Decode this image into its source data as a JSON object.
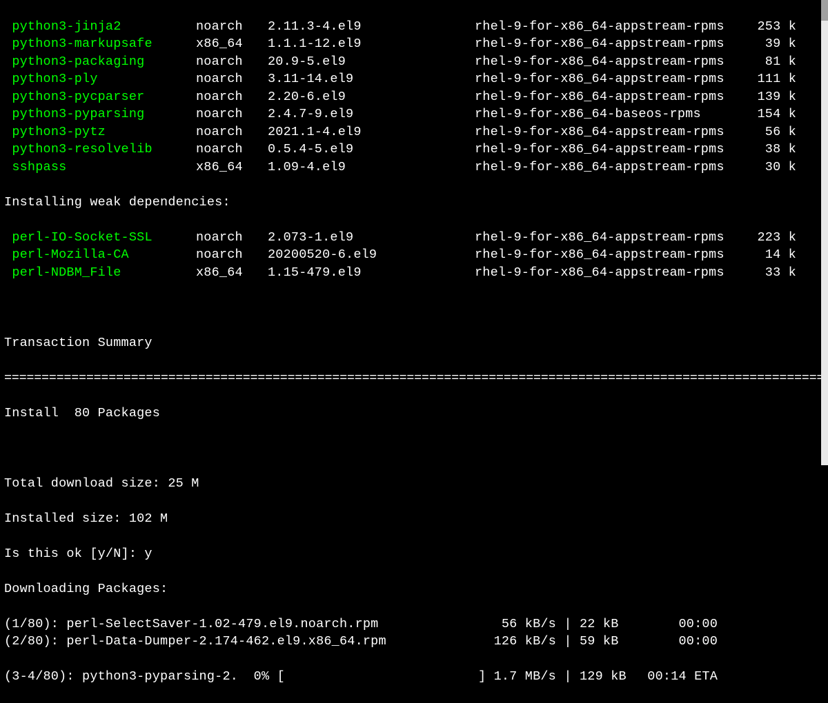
{
  "packages": [
    {
      "name": "python3-jinja2",
      "arch": "noarch",
      "version": "2.11.3-4.el9",
      "repo": "rhel-9-for-x86_64-appstream-rpms",
      "size": "253 k"
    },
    {
      "name": "python3-markupsafe",
      "arch": "x86_64",
      "version": "1.1.1-12.el9",
      "repo": "rhel-9-for-x86_64-appstream-rpms",
      "size": "39 k"
    },
    {
      "name": "python3-packaging",
      "arch": "noarch",
      "version": "20.9-5.el9",
      "repo": "rhel-9-for-x86_64-appstream-rpms",
      "size": "81 k"
    },
    {
      "name": "python3-ply",
      "arch": "noarch",
      "version": "3.11-14.el9",
      "repo": "rhel-9-for-x86_64-appstream-rpms",
      "size": "111 k"
    },
    {
      "name": "python3-pycparser",
      "arch": "noarch",
      "version": "2.20-6.el9",
      "repo": "rhel-9-for-x86_64-appstream-rpms",
      "size": "139 k"
    },
    {
      "name": "python3-pyparsing",
      "arch": "noarch",
      "version": "2.4.7-9.el9",
      "repo": "rhel-9-for-x86_64-baseos-rpms",
      "size": "154 k"
    },
    {
      "name": "python3-pytz",
      "arch": "noarch",
      "version": "2021.1-4.el9",
      "repo": "rhel-9-for-x86_64-appstream-rpms",
      "size": "56 k"
    },
    {
      "name": "python3-resolvelib",
      "arch": "noarch",
      "version": "0.5.4-5.el9",
      "repo": "rhel-9-for-x86_64-appstream-rpms",
      "size": "38 k"
    },
    {
      "name": "sshpass",
      "arch": "x86_64",
      "version": "1.09-4.el9",
      "repo": "rhel-9-for-x86_64-appstream-rpms",
      "size": "30 k"
    }
  ],
  "weak_header": "Installing weak dependencies:",
  "weak_packages": [
    {
      "name": "perl-IO-Socket-SSL",
      "arch": "noarch",
      "version": "2.073-1.el9",
      "repo": "rhel-9-for-x86_64-appstream-rpms",
      "size": "223 k"
    },
    {
      "name": "perl-Mozilla-CA",
      "arch": "noarch",
      "version": "20200520-6.el9",
      "repo": "rhel-9-for-x86_64-appstream-rpms",
      "size": "14 k"
    },
    {
      "name": "perl-NDBM_File",
      "arch": "x86_64",
      "version": "1.15-479.el9",
      "repo": "rhel-9-for-x86_64-appstream-rpms",
      "size": "33 k"
    }
  ],
  "summary_title": "Transaction Summary",
  "divider": "===============================================================================================================",
  "install_line": "Install  80 Packages",
  "total_dl": "Total download size: 25 M",
  "installed_size": "Installed size: 102 M",
  "confirm": "Is this ok [y/N]: y",
  "downloading_header": "Downloading Packages:",
  "downloads": [
    {
      "label": "(1/80): perl-SelectSaver-1.02-479.el9.noarch.rpm",
      "speed": "56 kB/s",
      "sep": "|",
      "amount": "22 kB",
      "time": "00:00"
    },
    {
      "label": "(2/80): perl-Data-Dumper-2.174-462.el9.x86_64.rpm",
      "speed": "126 kB/s",
      "sep": "|",
      "amount": "59 kB",
      "time": "00:00"
    }
  ],
  "progress": {
    "label": "(3-4/80): python3-pyparsing-2.  0% [",
    "speed": "] 1.7 MB/s",
    "sep": "|",
    "amount": "129 kB",
    "time": "00:14 ETA"
  }
}
